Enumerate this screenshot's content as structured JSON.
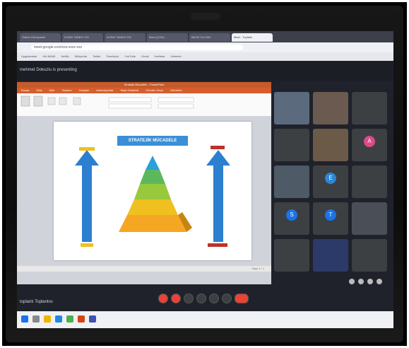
{
  "browser": {
    "tabs": [
      "Online Görüşmeler",
      "KOSKI TANECİ OO",
      "KOSKI TANECİ OO",
      "Meet (ÇOK)...",
      "BATIK OLCÜM",
      "Meet - Toplantı"
    ],
    "url": "meet.google.com/xxx-xxxx-xxx",
    "bookmarks": [
      "Uygulamalar",
      "Hbl BANK",
      "Netflix",
      "Wikipedia",
      "Twitter",
      "Facebook",
      "YouTube",
      "Gmail",
      "Haritalar",
      "Haberler"
    ]
  },
  "meet": {
    "presenting_text": "mehmet Dokuzlu is presenting",
    "meeting_name": "toplantı Toplantısı",
    "controls": [
      "mic",
      "camera",
      "captions",
      "raise-hand",
      "present",
      "more",
      "end-call"
    ]
  },
  "powerpoint": {
    "window_title": "Stratejik Mücadele - PowerPoint",
    "ribbon_tabs": [
      "Dosya",
      "Giriş",
      "Ekle",
      "Tasarım",
      "Geçişler",
      "Animasyonlar",
      "Slayt Gösterisi",
      "Gözden Geçir",
      "Görünüm"
    ],
    "slide_title": "STRATEJİK MÜCADELE",
    "statusbar": "Slayt 1 / 1"
  },
  "participants": [
    {
      "name": "",
      "avatar": "",
      "color": "#5b6b7d"
    },
    {
      "name": "",
      "avatar": "",
      "color": "#6a5a50"
    },
    {
      "name": "",
      "avatar": "",
      "color": "#3c4043"
    },
    {
      "name": "",
      "avatar": "",
      "color": "#3c4043"
    },
    {
      "name": "",
      "avatar": "",
      "color": "#6b5a48"
    },
    {
      "name": "",
      "avatar": "A",
      "color": "#d94c89"
    },
    {
      "name": "",
      "avatar": "",
      "color": "#4e5a66"
    },
    {
      "name": "",
      "avatar": "E",
      "color": "#2c87d4"
    },
    {
      "name": "",
      "avatar": "",
      "color": "#3c4043"
    },
    {
      "name": "",
      "avatar": "S",
      "color": "#1a73e8"
    },
    {
      "name": "",
      "avatar": "T",
      "color": "#1a73e8"
    },
    {
      "name": "",
      "avatar": "",
      "color": "#4a4f57"
    },
    {
      "name": "",
      "avatar": "",
      "color": "#3c4043"
    },
    {
      "name": "",
      "avatar": "",
      "color": "#2c3a6a"
    },
    {
      "name": "",
      "avatar": "",
      "color": "#3c4043"
    }
  ],
  "icons": [
    "camera-icon",
    "mic-icon",
    "present-icon",
    "end-call-icon",
    "people-icon",
    "chat-icon",
    "windows-start-icon"
  ]
}
